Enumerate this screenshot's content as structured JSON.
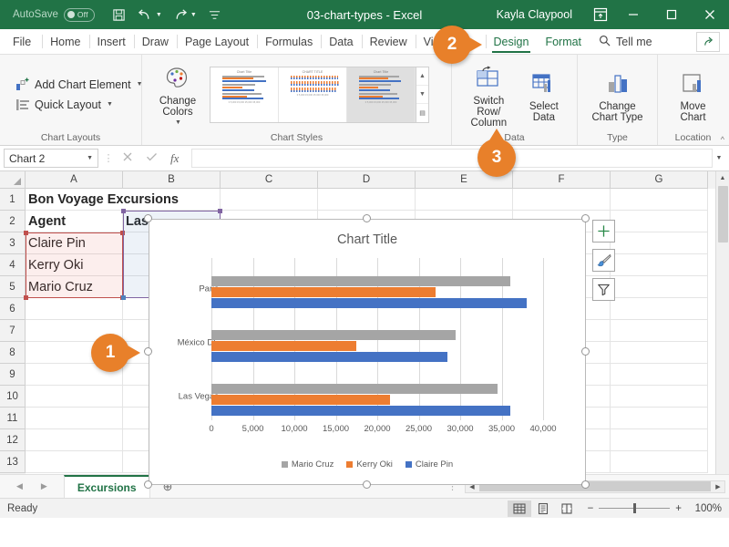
{
  "titlebar": {
    "autosave_label": "AutoSave",
    "autosave_state": "Off",
    "document_title": "03-chart-types  -  Excel",
    "user_name": "Kayla Claypool",
    "qat": [
      {
        "name": "save-icon",
        "label": "Save"
      },
      {
        "name": "undo-icon",
        "label": "Undo"
      },
      {
        "name": "redo-icon",
        "label": "Redo"
      },
      {
        "name": "customize-qat-icon",
        "label": "Customize Quick Access Toolbar"
      }
    ],
    "window": [
      {
        "name": "ribbon-display-options-icon",
        "label": "Ribbon Display Options"
      },
      {
        "name": "minimize-icon",
        "label": "Minimize"
      },
      {
        "name": "restore-icon",
        "label": "Restore Down"
      },
      {
        "name": "close-icon",
        "label": "Close"
      }
    ]
  },
  "ribbon_tabs": [
    {
      "label": "File",
      "kind": "file"
    },
    {
      "label": "Home",
      "kind": "normal"
    },
    {
      "label": "Insert",
      "kind": "normal"
    },
    {
      "label": "Draw",
      "kind": "normal"
    },
    {
      "label": "Page Layout",
      "kind": "normal"
    },
    {
      "label": "Formulas",
      "kind": "normal"
    },
    {
      "label": "Data",
      "kind": "normal"
    },
    {
      "label": "Review",
      "kind": "normal"
    },
    {
      "label": "View",
      "kind": "normal"
    },
    {
      "label": "Design",
      "kind": "contextual-active"
    },
    {
      "label": "Format",
      "kind": "contextual"
    }
  ],
  "tellme": {
    "label": "Tell me",
    "icon": "search-icon"
  },
  "share": {
    "label": "Share",
    "icon": "share-icon"
  },
  "ribbon": {
    "groups": [
      {
        "label": "Chart Layouts",
        "buttons": [
          {
            "label": "Add Chart Element",
            "icon": "add-chart-element-icon",
            "has_dropdown": true
          },
          {
            "label": "Quick Layout",
            "icon": "quick-layout-icon",
            "has_dropdown": true
          }
        ]
      },
      {
        "label": "Chart Styles",
        "buttons": [
          {
            "label": "Change\nColors",
            "icon": "change-colors-icon",
            "has_dropdown": true
          }
        ],
        "gallery_items": [
          {
            "name": "chart-style-1",
            "title": "Chart Title",
            "selected": false
          },
          {
            "name": "chart-style-2",
            "title": "CHART TITLE",
            "selected": false
          },
          {
            "name": "chart-style-3",
            "title": "Chart Title",
            "selected": true
          }
        ],
        "gallery_scroll": [
          "▲",
          "▼",
          "▤"
        ]
      },
      {
        "label": "Data",
        "buttons": [
          {
            "label": "Switch Row/\nColumn",
            "icon": "switch-row-column-icon",
            "has_dropdown": false
          },
          {
            "label": "Select\nData",
            "icon": "select-data-icon",
            "has_dropdown": false
          }
        ]
      },
      {
        "label": "Type",
        "buttons": [
          {
            "label": "Change\nChart Type",
            "icon": "change-chart-type-icon",
            "has_dropdown": false
          }
        ]
      },
      {
        "label": "Location",
        "buttons": [
          {
            "label": "Move\nChart",
            "icon": "move-chart-icon",
            "has_dropdown": false
          }
        ]
      }
    ],
    "collapse_label": "^"
  },
  "formulabar": {
    "namebox_value": "Chart 2",
    "cancel_icon": "cancel-icon",
    "enter_icon": "enter-icon",
    "fx_icon": "insert-function-icon",
    "input_value": "",
    "expand_icon": "expand-formula-bar-icon"
  },
  "grid": {
    "columns": [
      "A",
      "B",
      "C",
      "D",
      "E",
      "F",
      "G"
    ],
    "rows": [
      "1",
      "2",
      "3",
      "4",
      "5",
      "6",
      "7",
      "8",
      "9",
      "10",
      "11",
      "12",
      "13"
    ],
    "cells": {
      "A1": "Bon Voyage Excursions",
      "A2": "Agent",
      "B2": "Las",
      "A3": "Claire Pin",
      "A4": "Kerry Oki",
      "A5": "Mario Cruz"
    }
  },
  "chart": {
    "title": "Chart Title",
    "element_buttons": [
      {
        "name": "chart-elements-button",
        "icon": "plus-icon",
        "label": "Chart Elements"
      },
      {
        "name": "chart-styles-button",
        "icon": "paintbrush-icon",
        "label": "Chart Styles"
      },
      {
        "name": "chart-filters-button",
        "icon": "funnel-icon",
        "label": "Chart Filters"
      }
    ]
  },
  "chart_data": {
    "type": "bar",
    "title": "Chart Title",
    "xlabel": "",
    "ylabel": "",
    "categories": [
      "Paris",
      "México DF",
      "Las Vegas"
    ],
    "series": [
      {
        "name": "Claire Pin",
        "color": "#4472c4",
        "values": [
          38000,
          28500,
          36000
        ]
      },
      {
        "name": "Kerry Oki",
        "color": "#ed7d31",
        "values": [
          27000,
          17500,
          21500
        ]
      },
      {
        "name": "Mario Cruz",
        "color": "#a5a5a5",
        "values": [
          36000,
          29500,
          34500
        ]
      }
    ],
    "legend_order": [
      "Mario Cruz",
      "Kerry Oki",
      "Claire Pin"
    ],
    "xticks": [
      "0",
      "5,000",
      "10,000",
      "15,000",
      "20,000",
      "25,000",
      "30,000",
      "35,000",
      "40,000"
    ],
    "xlim": [
      0,
      40000
    ],
    "grid": true,
    "legend_position": "bottom",
    "orientation": "horizontal"
  },
  "callouts": [
    {
      "number": "1",
      "direction": "right"
    },
    {
      "number": "2",
      "direction": "right"
    },
    {
      "number": "3",
      "direction": "up"
    }
  ],
  "sheetbar": {
    "prev_icon": "previous-sheet-icon",
    "next_icon": "next-sheet-icon",
    "tabs": [
      {
        "label": "Excursions",
        "active": true
      }
    ],
    "add_sheet_icon": "add-sheet-icon",
    "add_sheet_label": "New sheet"
  },
  "statusbar": {
    "status": "Ready",
    "views": [
      {
        "name": "normal-view-button",
        "icon": "grid-icon",
        "active": true
      },
      {
        "name": "page-layout-view-button",
        "icon": "page-icon",
        "active": false
      },
      {
        "name": "page-break-view-button",
        "icon": "page-break-icon",
        "active": false
      }
    ],
    "zoom_out_label": "−",
    "zoom_in_label": "+",
    "zoom_level": "100%"
  },
  "colors": {
    "excel_green": "#217346",
    "accent_orange": "#e8802a",
    "series_blue": "#4472c4",
    "series_orange": "#ed7d31",
    "series_gray": "#a5a5a5"
  }
}
